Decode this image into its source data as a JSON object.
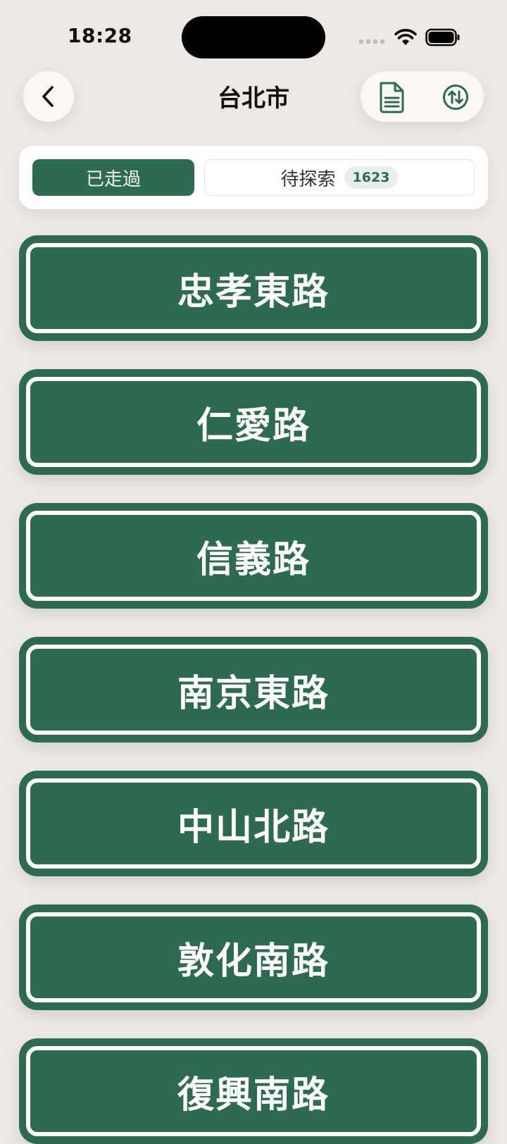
{
  "status_bar": {
    "time": "18:28"
  },
  "header": {
    "title": "台北市"
  },
  "tabs": {
    "visited_label": "已走過",
    "pending_label": "待探索",
    "pending_count": "1623"
  },
  "roads": [
    "忠孝東路",
    "仁愛路",
    "信義路",
    "南京東路",
    "中山北路",
    "敦化南路",
    "復興南路"
  ],
  "colors": {
    "accent": "#2E6A50",
    "background": "#ECE8E4"
  },
  "icons": {
    "back": "chevron-left-icon",
    "document": "document-icon",
    "sort": "sort-arrows-icon"
  }
}
